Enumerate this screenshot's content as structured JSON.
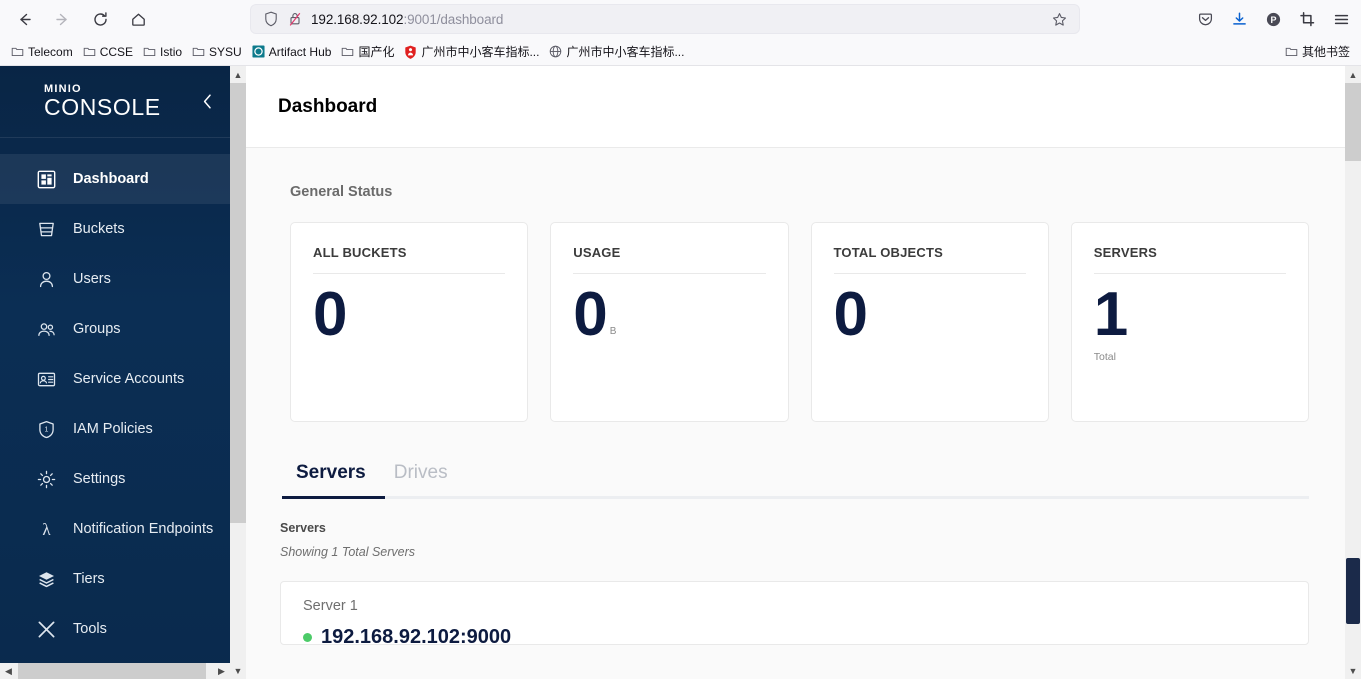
{
  "browser": {
    "nav": {
      "back": "back-arrow",
      "forward": "forward-arrow",
      "reload": "reload",
      "home": "home"
    },
    "url": {
      "host": "192.168.92.102",
      "path": ":9001/dashboard",
      "shield_icon": "shield-icon",
      "lock_icon": "lock-crossed-icon",
      "bookmark_icon": "star-icon"
    },
    "toolbar_icons": [
      "pocket-icon",
      "download-icon",
      "profile-icon",
      "screenshot-icon",
      "menu-icon"
    ],
    "bookmarks": [
      {
        "label": "Telecom",
        "icon": "folder-icon"
      },
      {
        "label": "CCSE",
        "icon": "folder-icon"
      },
      {
        "label": "Istio",
        "icon": "folder-icon"
      },
      {
        "label": "SYSU",
        "icon": "folder-icon"
      },
      {
        "label": "Artifact Hub",
        "icon": "hexagon-icon"
      },
      {
        "label": "国产化",
        "icon": "folder-icon"
      },
      {
        "label": "广州市中小客车指标...",
        "icon": "shield-red-icon"
      },
      {
        "label": "广州市中小客车指标...",
        "icon": "globe-icon"
      }
    ],
    "other_bookmarks": {
      "label": "其他书签",
      "icon": "folder-icon"
    }
  },
  "sidebar": {
    "brand_top": "MINIO",
    "brand_bottom": "CONSOLE",
    "collapse_icon": "chevron-left-icon",
    "items": [
      {
        "label": "Dashboard",
        "icon": "dashboard-icon",
        "active": true
      },
      {
        "label": "Buckets",
        "icon": "bucket-icon",
        "active": false
      },
      {
        "label": "Users",
        "icon": "user-icon",
        "active": false
      },
      {
        "label": "Groups",
        "icon": "groups-icon",
        "active": false
      },
      {
        "label": "Service Accounts",
        "icon": "id-card-icon",
        "active": false
      },
      {
        "label": "IAM Policies",
        "icon": "shield-icon",
        "active": false
      },
      {
        "label": "Settings",
        "icon": "gear-icon",
        "active": false
      },
      {
        "label": "Notification Endpoints",
        "icon": "lambda-icon",
        "active": false
      },
      {
        "label": "Tiers",
        "icon": "layers-icon",
        "active": false
      },
      {
        "label": "Tools",
        "icon": "tools-icon",
        "active": false
      }
    ]
  },
  "page": {
    "title": "Dashboard",
    "section_label": "General Status",
    "cards": [
      {
        "title": "ALL BUCKETS",
        "value": "0",
        "unit": "",
        "sub": ""
      },
      {
        "title": "USAGE",
        "value": "0",
        "unit": "B",
        "sub": ""
      },
      {
        "title": "TOTAL OBJECTS",
        "value": "0",
        "unit": "",
        "sub": ""
      },
      {
        "title": "SERVERS",
        "value": "1",
        "unit": "",
        "sub": "Total"
      }
    ],
    "tabs": [
      {
        "label": "Servers",
        "active": true
      },
      {
        "label": "Drives",
        "active": false
      }
    ],
    "servers_section": {
      "label": "Servers",
      "count_text": "Showing 1 Total Servers",
      "servers": [
        {
          "name": "Server 1",
          "address": "192.168.92.102:9000",
          "status": "online"
        }
      ]
    }
  },
  "colors": {
    "sidebar_bg": "#0b2e54",
    "accent_navy": "#0d1b40",
    "status_green": "#4ccb68"
  }
}
